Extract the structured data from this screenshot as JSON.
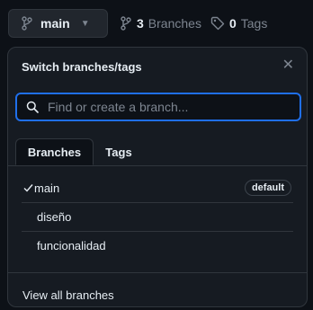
{
  "header": {
    "branch_name": "main",
    "branches_count": "3",
    "branches_label": "Branches",
    "tags_count": "0",
    "tags_label": "Tags"
  },
  "panel": {
    "title": "Switch branches/tags",
    "search_placeholder": "Find or create a branch...",
    "tabs": [
      {
        "label": "Branches",
        "active": true
      },
      {
        "label": "Tags",
        "active": false
      }
    ],
    "branches": [
      {
        "name": "main",
        "selected": true,
        "badge": "default"
      },
      {
        "name": "diseño",
        "selected": false
      },
      {
        "name": "funcionalidad",
        "selected": false
      }
    ],
    "footer_link": "View all branches"
  },
  "icons": {
    "branch": "git-branch-icon",
    "tag": "tag-icon",
    "search": "search-icon",
    "close": "close-icon",
    "check": "check-icon",
    "caret": "caret-down-icon"
  },
  "colors": {
    "background": "#0d1117",
    "panel": "#161b22",
    "border": "#30363d",
    "focus": "#1f6feb",
    "muted": "#7d8590"
  }
}
